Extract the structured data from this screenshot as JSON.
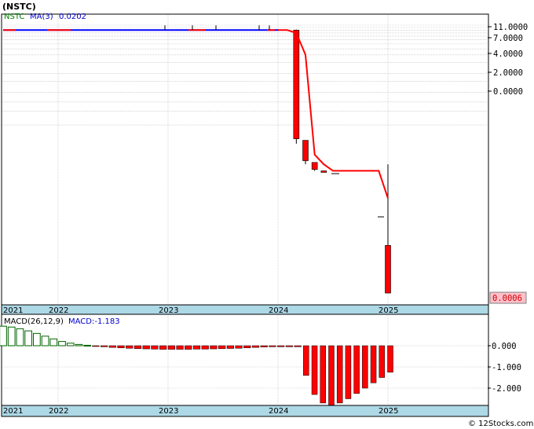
{
  "title": "(NSTC)",
  "watermark": "© 12Stocks.com",
  "chart_data": [
    {
      "type": "candlestick",
      "panel": "price",
      "legend": {
        "symbol": "NSTC",
        "ma_label": "MA(3)",
        "ma_value": "0.0202"
      },
      "y_scale": "log",
      "y_tick_labels": [
        "11.0000",
        "7.0000",
        "4.0000",
        "2.0000",
        "0.0000"
      ],
      "last_price_label": "0.0006",
      "x_tick_labels": [
        "2021",
        "2022",
        "2023",
        "2024",
        "2025"
      ],
      "grid": true,
      "price_segments": [
        {
          "from": "2021-01",
          "to": "2023-11",
          "approx_price": 10.0,
          "note_color": "blue line with red segments"
        }
      ],
      "candles": [
        {
          "date": "2024-03",
          "open": 10.0,
          "high": 10.2,
          "low": 0.15,
          "close": 0.18
        },
        {
          "date": "2024-04",
          "open": 0.17,
          "high": 0.17,
          "low": 0.07,
          "close": 0.08
        },
        {
          "date": "2024-05",
          "open": 0.075,
          "high": 0.075,
          "low": 0.055,
          "close": 0.058
        },
        {
          "date": "2024-06",
          "open": 0.055,
          "high": 0.055,
          "low": 0.055,
          "close": 0.055
        },
        {
          "date": "2025-01",
          "open": 0.0035,
          "high": 0.07,
          "low": 0.0006,
          "close": 0.0006
        }
      ],
      "ma_series": [
        {
          "date": "2024-01",
          "value": 10.0
        },
        {
          "date": "2024-02",
          "value": 10.0
        },
        {
          "date": "2024-03",
          "value": 9.0
        },
        {
          "date": "2024-04",
          "value": 4.0
        },
        {
          "date": "2024-05",
          "value": 0.1
        },
        {
          "date": "2024-06",
          "value": 0.07
        },
        {
          "date": "2024-07",
          "value": 0.055
        },
        {
          "date": "2024-12",
          "value": 0.055
        },
        {
          "date": "2025-01",
          "value": 0.02
        }
      ]
    },
    {
      "type": "bar",
      "panel": "macd",
      "legend": {
        "label": "MACD(26,12,9)",
        "value_label": "MACD:-1.183"
      },
      "y_tick_labels": [
        "0.000",
        "-1.000",
        "-2.000"
      ],
      "ylim": [
        -2.8,
        1.0
      ],
      "x_tick_labels": [
        "2021",
        "2022",
        "2023",
        "2024",
        "2025"
      ],
      "values": [
        0.92,
        0.88,
        0.8,
        0.7,
        0.58,
        0.45,
        0.32,
        0.2,
        0.12,
        0.06,
        0.02,
        -0.02,
        -0.05,
        -0.08,
        -0.1,
        -0.12,
        -0.14,
        -0.15,
        -0.16,
        -0.17,
        -0.17,
        -0.17,
        -0.17,
        -0.16,
        -0.16,
        -0.15,
        -0.14,
        -0.13,
        -0.12,
        -0.1,
        -0.08,
        -0.06,
        -0.05,
        -0.05,
        -0.05,
        -0.05,
        -1.4,
        -2.3,
        -2.7,
        -2.8,
        -2.7,
        -2.5,
        -2.25,
        -2.0,
        -1.75,
        -1.5,
        -1.25
      ]
    }
  ]
}
